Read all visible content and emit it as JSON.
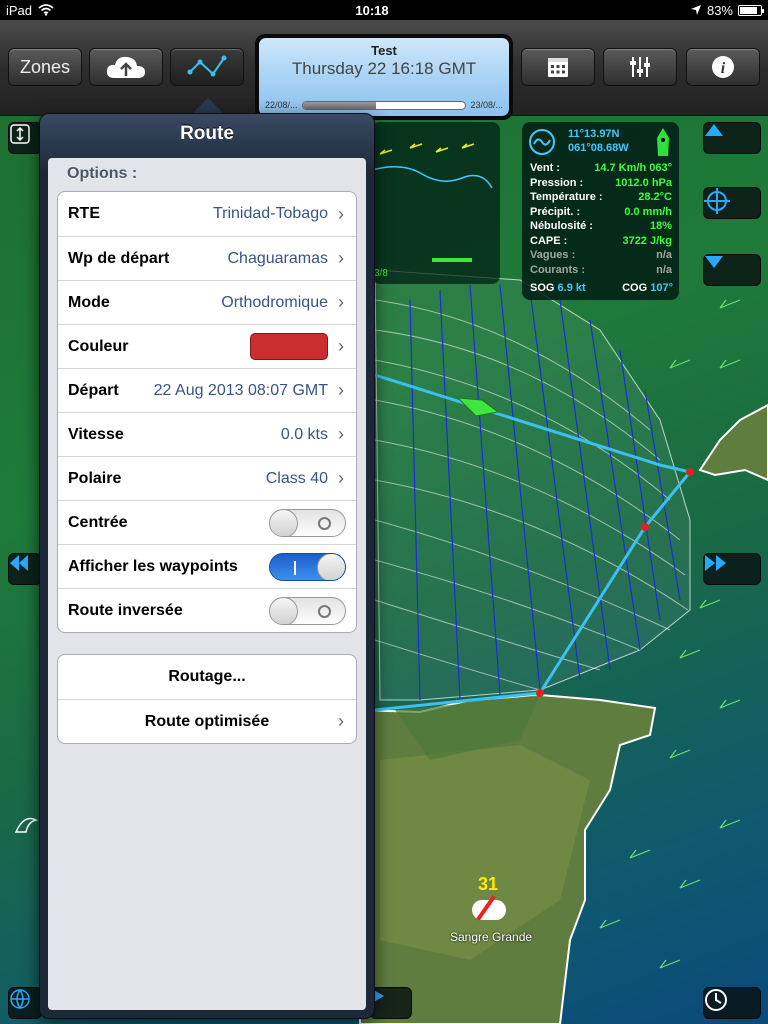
{
  "status_bar": {
    "device": "iPad",
    "time": "10:18",
    "battery": "83%"
  },
  "toolbar": {
    "zones_label": "Zones",
    "time_panel": {
      "title": "Test",
      "datetime": "Thursday 22 16:18 GMT",
      "start": "22/08/...",
      "end": "23/08/...",
      "progress": 0.45
    }
  },
  "weather": {
    "lat": "11°13.97N",
    "lon": "061°08.68W",
    "rows": [
      {
        "label": "Vent :",
        "value": "14.7 Km/h 063°",
        "dim": false
      },
      {
        "label": "Pression :",
        "value": "1012.0 hPa",
        "dim": false
      },
      {
        "label": "Température :",
        "value": "28.2°C",
        "dim": false
      },
      {
        "label": "Précipit. :",
        "value": "0.0 mm/h",
        "dim": false
      },
      {
        "label": "Nébulosité :",
        "value": "18%",
        "dim": false
      },
      {
        "label": "CAPE :",
        "value": "3722 J/kg",
        "dim": false
      },
      {
        "label": "Vagues :",
        "value": "n/a",
        "dim": true
      },
      {
        "label": "Courants :",
        "value": "n/a",
        "dim": true
      }
    ],
    "sog_label": "SOG",
    "sog_value": "6.9 kt",
    "cog_label": "COG",
    "cog_value": "107°"
  },
  "map": {
    "waypoint_number": "31",
    "place_name": "Sangre Grande",
    "graph_fragment": "3/8"
  },
  "popover": {
    "title": "Route",
    "section_label": "Options :",
    "rows": {
      "rte": {
        "label": "RTE",
        "value": "Trinidad-Tobago"
      },
      "wp": {
        "label": "Wp de départ",
        "value": "Chaguaramas"
      },
      "mode": {
        "label": "Mode",
        "value": "Orthodromique"
      },
      "color": {
        "label": "Couleur",
        "color": "#cb2e2f"
      },
      "depart": {
        "label": "Départ",
        "value": "22 Aug 2013 08:07 GMT"
      },
      "speed": {
        "label": "Vitesse",
        "value": "0.0 kts"
      },
      "polar": {
        "label": "Polaire",
        "value": "Class 40"
      },
      "centered": {
        "label": "Centrée",
        "on": false
      },
      "show_wp": {
        "label": "Afficher les waypoints",
        "on": true
      },
      "reversed": {
        "label": "Route inversée",
        "on": false
      }
    },
    "actions": {
      "routing": "Routage...",
      "optimized": "Route optimisée"
    }
  },
  "colors": {
    "route": "#3cc0f0",
    "isochrone": "#1a2fd8",
    "accent_blue": "#42c8ff",
    "value_green": "#3cff3c"
  }
}
